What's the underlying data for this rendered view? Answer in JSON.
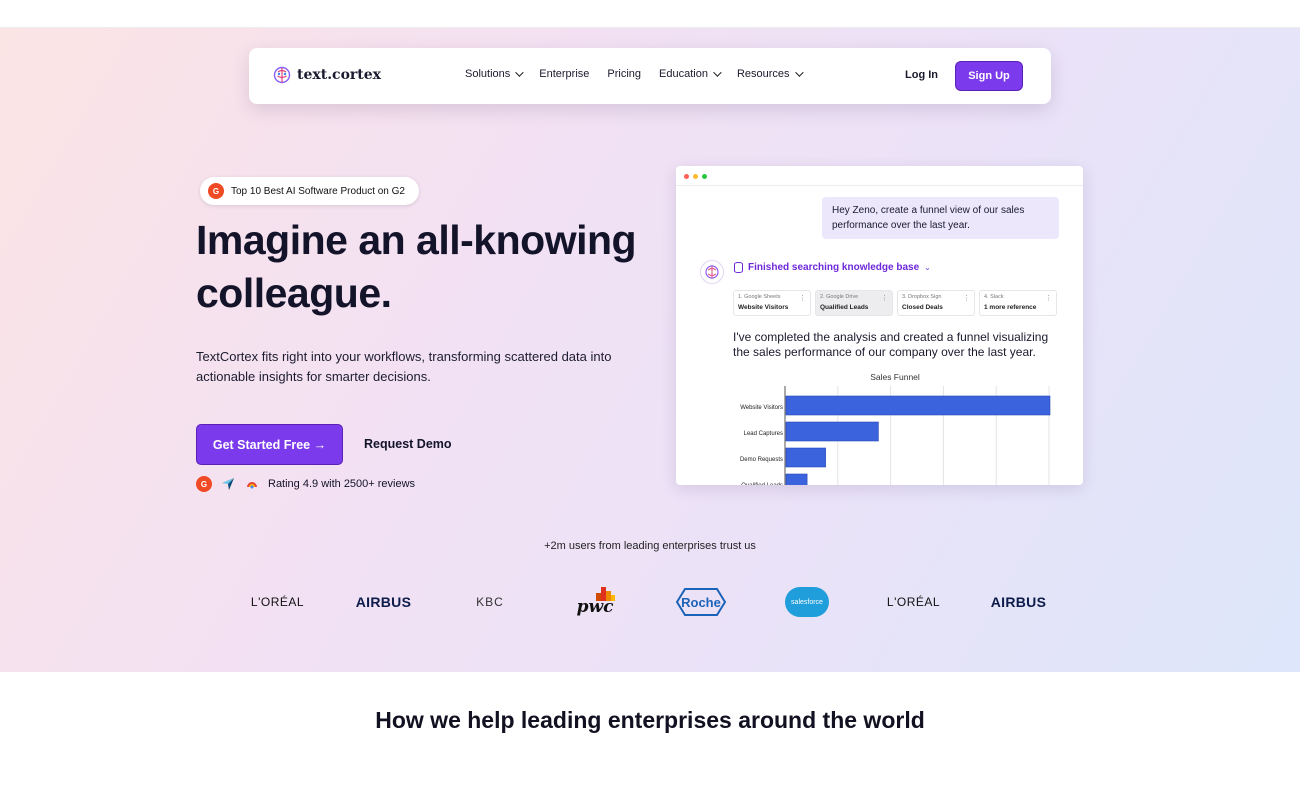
{
  "nav": {
    "logo_text": "text.cortex",
    "menu": [
      {
        "label": "Solutions",
        "dropdown": true
      },
      {
        "label": "Enterprise",
        "dropdown": false
      },
      {
        "label": "Pricing",
        "dropdown": false
      },
      {
        "label": "Education",
        "dropdown": true
      },
      {
        "label": "Resources",
        "dropdown": true
      }
    ],
    "login": "Log In",
    "signup": "Sign Up"
  },
  "hero": {
    "badge": "Top 10 Best AI Software Product on G2",
    "badge_icon_text": "G",
    "headline": "Imagine an all-knowing colleague.",
    "subtext": "TextCortex fits right into your workflows, transforming scattered data into actionable insights for smarter decisions.",
    "cta_primary": "Get Started Free →",
    "cta_secondary": "Request Demo",
    "rating_text": "Rating 4.9 with 2500+ reviews"
  },
  "demo_window": {
    "user_message": "Hey Zeno, create a funnel view of our sales performance over the last year.",
    "kb_status": "Finished searching knowledge base",
    "sources": [
      {
        "app": "1. Google Sheets",
        "title": "Website Visitors",
        "active": false
      },
      {
        "app": "2. Google Drive",
        "title": "Qualified Leads",
        "active": true
      },
      {
        "app": "3. Dropbox Sign",
        "title": "Closed Deals",
        "active": false
      },
      {
        "app": "4. Slack",
        "title": "1 more reference",
        "active": false
      }
    ],
    "answer": "I've completed the analysis and created a funnel visualizing the sales performance of our company over the last year."
  },
  "chart_data": {
    "type": "bar",
    "orientation": "horizontal",
    "title": "Sales Funnel",
    "categories": [
      "Website Visitors",
      "Lead Captures",
      "Demo Requests",
      "Qualified Leads"
    ],
    "values": [
      5000,
      1750,
      750,
      400
    ],
    "xlim": [
      0,
      5000
    ],
    "grid": true,
    "color": "#3b63dd"
  },
  "trust": {
    "text": "+2m users from leading enterprises trust us",
    "logos": [
      "L'ORÉAL",
      "AIRBUS",
      "KBC",
      "pwc",
      "Roche",
      "salesforce",
      "L'ORÉAL",
      "AIRBUS"
    ]
  },
  "section": {
    "title": "How we help leading enterprises around the world"
  },
  "colors": {
    "accent": "#7c3aed",
    "bar": "#3b63dd",
    "g2": "#ef4a23"
  }
}
